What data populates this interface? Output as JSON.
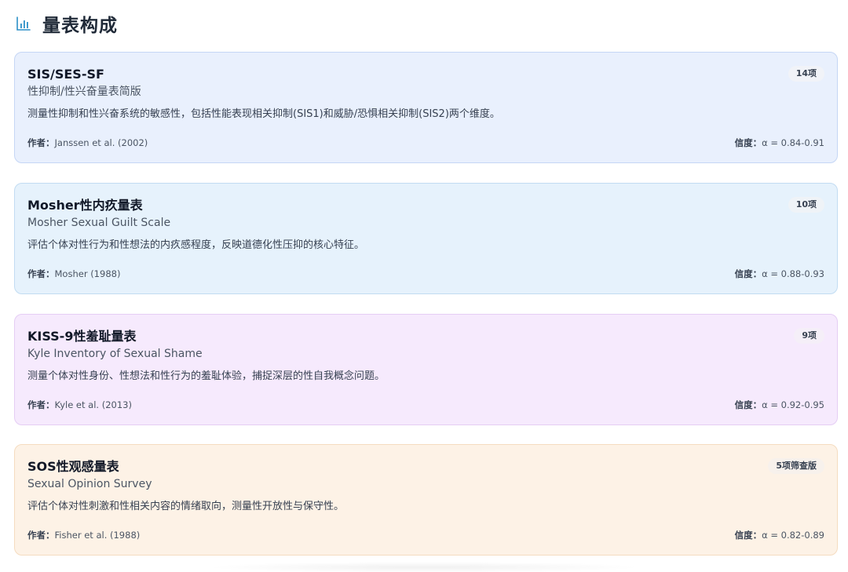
{
  "section": {
    "title": "量表构成",
    "icon": "bar-chart-icon",
    "accent_color": "#2b8fc7"
  },
  "cards": [
    {
      "name": "SIS/SES-SF",
      "subname": "性抑制/性兴奋量表简版",
      "badge": "14项",
      "desc": "测量性抑制和性兴奋系统的敏感性，包括性能表现相关抑制(SIS1)和威胁/恐惧相关抑制(SIS2)两个维度。",
      "author_label": "作者：",
      "author": "Janssen et al. (2002)",
      "reliability_label": "信度：",
      "reliability": "α = 0.84-0.91",
      "bg": "#e9f0fd",
      "border": "#c5d6f5",
      "badge_bg": "#f1f3f8"
    },
    {
      "name": "Mosher性内疚量表",
      "subname": "Mosher Sexual Guilt Scale",
      "badge": "10项",
      "desc": "评估个体对性行为和性想法的内疚感程度，反映道德化性压抑的核心特征。",
      "author_label": "作者：",
      "author": "Mosher (1988)",
      "reliability_label": "信度：",
      "reliability": "α = 0.88-0.93",
      "bg": "#e6f2fc",
      "border": "#c2dcf2",
      "badge_bg": "#eff3f7"
    },
    {
      "name": "KISS-9性羞耻量表",
      "subname": "Kyle Inventory of Sexual Shame",
      "badge": "9项",
      "desc": "测量个体对性身份、性想法和性行为的羞耻体验，捕捉深层的性自我概念问题。",
      "author_label": "作者：",
      "author": "Kyle et al. (2013)",
      "reliability_label": "信度：",
      "reliability": "α = 0.92-0.95",
      "bg": "#f6eafd",
      "border": "#e5cdf4",
      "badge_bg": "#f5eff8"
    },
    {
      "name": "SOS性观感量表",
      "subname": "Sexual Opinion Survey",
      "badge": "5项筛查版",
      "desc": "评估个体对性刺激和性相关内容的情绪取向，测量性开放性与保守性。",
      "author_label": "作者：",
      "author": "Fisher et al. (1988)",
      "reliability_label": "信度：",
      "reliability": "α = 0.82-0.89",
      "bg": "#fdf2e6",
      "border": "#f5dcc0",
      "badge_bg": "#f7f1ec"
    }
  ]
}
